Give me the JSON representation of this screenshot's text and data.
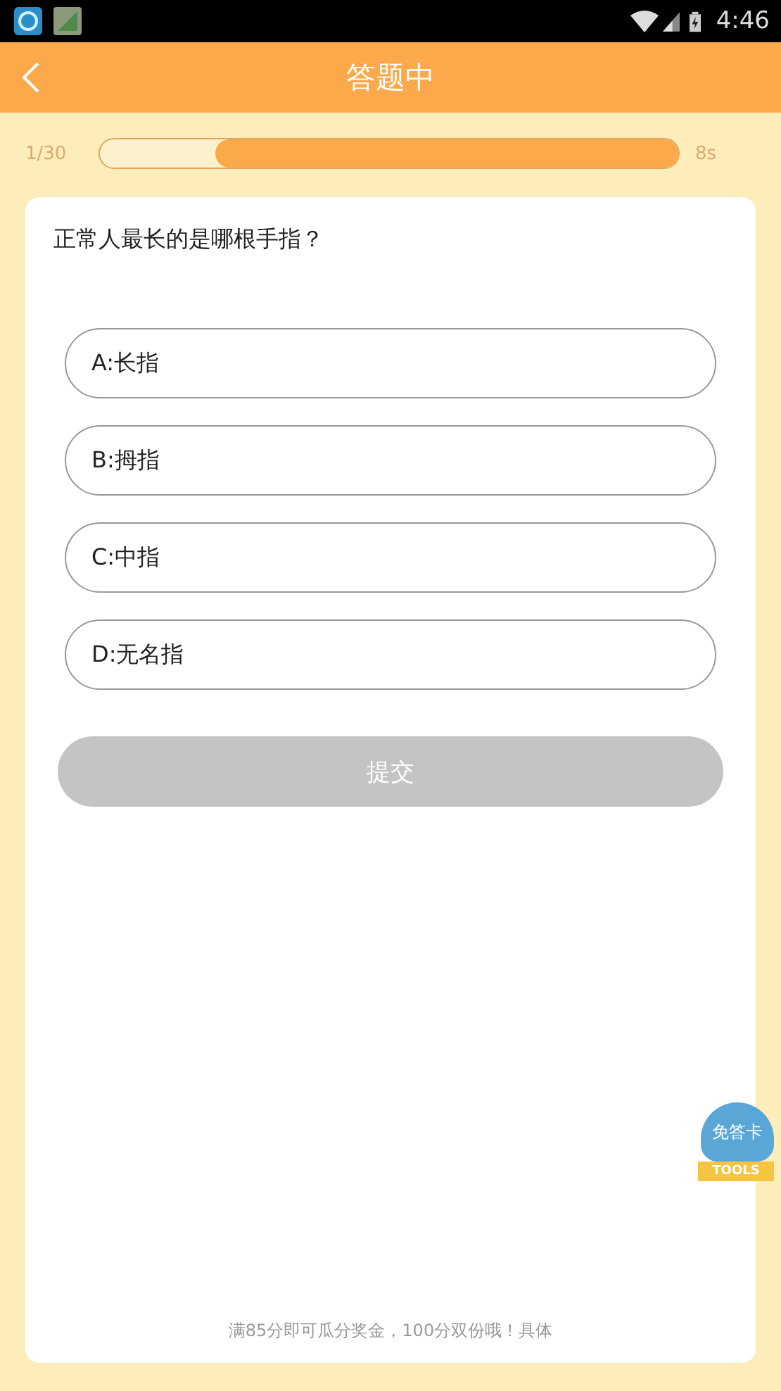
{
  "status_bar": {
    "time": "4:46"
  },
  "header": {
    "title": "答题中"
  },
  "progress": {
    "count": "1/30",
    "level": 0.8,
    "timer": "8s"
  },
  "question": {
    "text": "正常人最长的是哪根手指？",
    "options": [
      {
        "label": "A:长指",
        "selected": false
      },
      {
        "label": "B:拇指",
        "selected": false
      },
      {
        "label": "C:中指",
        "selected": false
      },
      {
        "label": "D:无名指",
        "selected": false
      }
    ]
  },
  "submit": {
    "label": "提交",
    "disabled": true
  },
  "footer_note": "满85分即可瓜分奖金，100分双份哦！具体",
  "floating_badge": {
    "label": "免答卡",
    "ribbon": "TOOLS"
  }
}
